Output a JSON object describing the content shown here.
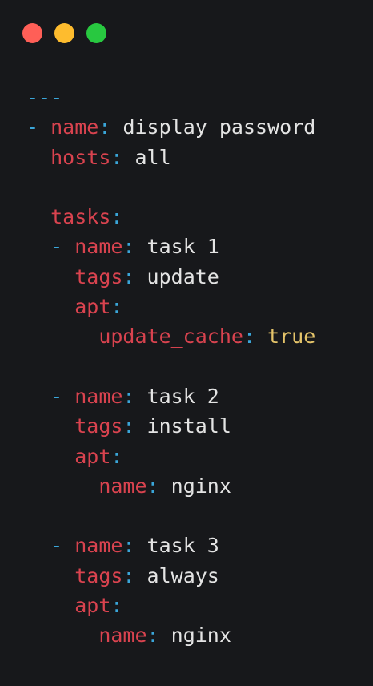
{
  "window": {
    "buttons": [
      {
        "name": "close",
        "color": "#ff5f57"
      },
      {
        "name": "minimize",
        "color": "#febc2e"
      },
      {
        "name": "maximize",
        "color": "#28c840"
      }
    ]
  },
  "theme": {
    "background": "#17181b",
    "key_color": "#d9434f",
    "punctuation_color": "#3aa6d9",
    "value_color": "#e4e4e4",
    "boolean_color": "#e5c46a"
  },
  "code": {
    "lines": [
      {
        "indent": "",
        "parts": [
          {
            "t": "p",
            "text": "---"
          }
        ]
      },
      {
        "indent": "",
        "parts": [
          {
            "t": "p",
            "text": "- "
          },
          {
            "t": "k",
            "text": "name"
          },
          {
            "t": "p",
            "text": ": "
          },
          {
            "t": "v",
            "text": "display password"
          }
        ]
      },
      {
        "indent": "  ",
        "parts": [
          {
            "t": "k",
            "text": "hosts"
          },
          {
            "t": "p",
            "text": ": "
          },
          {
            "t": "v",
            "text": "all"
          }
        ]
      },
      {
        "indent": "",
        "parts": []
      },
      {
        "indent": "  ",
        "parts": [
          {
            "t": "k",
            "text": "tasks"
          },
          {
            "t": "p",
            "text": ":"
          }
        ]
      },
      {
        "indent": "  ",
        "parts": [
          {
            "t": "p",
            "text": "- "
          },
          {
            "t": "k",
            "text": "name"
          },
          {
            "t": "p",
            "text": ": "
          },
          {
            "t": "v",
            "text": "task 1"
          }
        ]
      },
      {
        "indent": "    ",
        "parts": [
          {
            "t": "k",
            "text": "tags"
          },
          {
            "t": "p",
            "text": ": "
          },
          {
            "t": "v",
            "text": "update"
          }
        ]
      },
      {
        "indent": "    ",
        "parts": [
          {
            "t": "k",
            "text": "apt"
          },
          {
            "t": "p",
            "text": ":"
          }
        ]
      },
      {
        "indent": "      ",
        "parts": [
          {
            "t": "k",
            "text": "update_cache"
          },
          {
            "t": "p",
            "text": ": "
          },
          {
            "t": "b",
            "text": "true"
          }
        ]
      },
      {
        "indent": "",
        "parts": []
      },
      {
        "indent": "  ",
        "parts": [
          {
            "t": "p",
            "text": "- "
          },
          {
            "t": "k",
            "text": "name"
          },
          {
            "t": "p",
            "text": ": "
          },
          {
            "t": "v",
            "text": "task 2"
          }
        ]
      },
      {
        "indent": "    ",
        "parts": [
          {
            "t": "k",
            "text": "tags"
          },
          {
            "t": "p",
            "text": ": "
          },
          {
            "t": "v",
            "text": "install"
          }
        ]
      },
      {
        "indent": "    ",
        "parts": [
          {
            "t": "k",
            "text": "apt"
          },
          {
            "t": "p",
            "text": ":"
          }
        ]
      },
      {
        "indent": "      ",
        "parts": [
          {
            "t": "k",
            "text": "name"
          },
          {
            "t": "p",
            "text": ": "
          },
          {
            "t": "v",
            "text": "nginx"
          }
        ]
      },
      {
        "indent": "",
        "parts": []
      },
      {
        "indent": "  ",
        "parts": [
          {
            "t": "p",
            "text": "- "
          },
          {
            "t": "k",
            "text": "name"
          },
          {
            "t": "p",
            "text": ": "
          },
          {
            "t": "v",
            "text": "task 3"
          }
        ]
      },
      {
        "indent": "    ",
        "parts": [
          {
            "t": "k",
            "text": "tags"
          },
          {
            "t": "p",
            "text": ": "
          },
          {
            "t": "v",
            "text": "always"
          }
        ]
      },
      {
        "indent": "    ",
        "parts": [
          {
            "t": "k",
            "text": "apt"
          },
          {
            "t": "p",
            "text": ":"
          }
        ]
      },
      {
        "indent": "      ",
        "parts": [
          {
            "t": "k",
            "text": "name"
          },
          {
            "t": "p",
            "text": ": "
          },
          {
            "t": "v",
            "text": "nginx"
          }
        ]
      }
    ]
  }
}
